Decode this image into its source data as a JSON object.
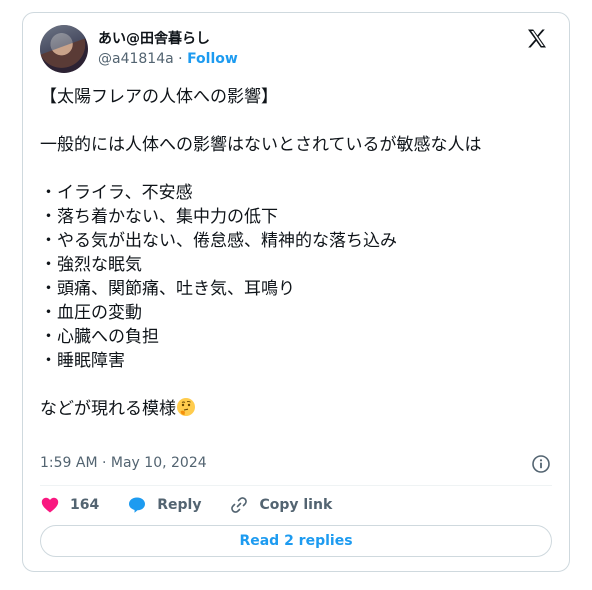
{
  "tweet": {
    "author_name": "あい@田舎暮らし",
    "handle": "@a41814a",
    "separator": " · ",
    "follow_label": "Follow",
    "body": "【太陽フレアの人体への影響】\n\n一般的には人体への影響はないとされているが敏感な人は\n\n・イライラ、不安感\n・落ち着かない、集中力の低下\n・やる気が出ない、倦怠感、精神的な落ち込み\n・強烈な眠気\n・頭痛、関節痛、吐き気、耳鳴り\n・血圧の変動\n・心臓への負担\n・睡眠障害\n\nなどが現れる模様",
    "emoji": "thinking-face-icon",
    "timestamp": "1:59 AM · May 10, 2024"
  },
  "actions": {
    "like_count": "164",
    "reply_label": "Reply",
    "copy_link_label": "Copy link"
  },
  "read_replies_label": "Read 2 replies",
  "colors": {
    "accent": "#1d9bf0",
    "like": "#f91880",
    "muted": "#536471",
    "border": "#cfd9de"
  }
}
